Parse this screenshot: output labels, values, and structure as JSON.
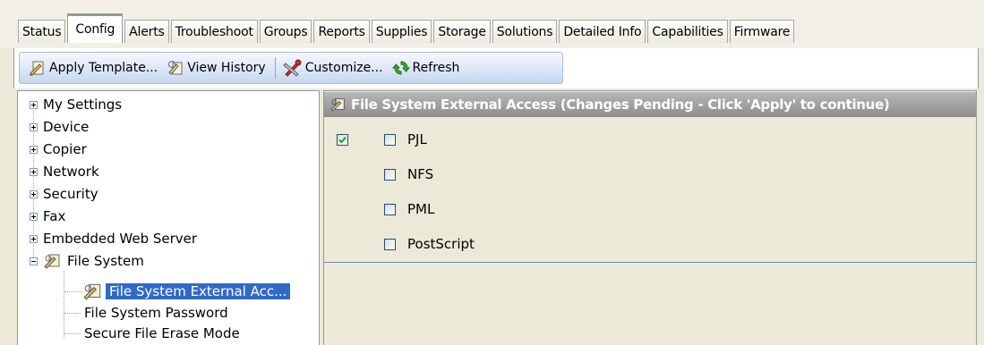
{
  "tabs": [
    {
      "label": "Status",
      "active": false
    },
    {
      "label": "Config",
      "active": true
    },
    {
      "label": "Alerts",
      "active": false
    },
    {
      "label": "Troubleshoot",
      "active": false
    },
    {
      "label": "Groups",
      "active": false
    },
    {
      "label": "Reports",
      "active": false
    },
    {
      "label": "Supplies",
      "active": false
    },
    {
      "label": "Storage",
      "active": false
    },
    {
      "label": "Solutions",
      "active": false
    },
    {
      "label": "Detailed Info",
      "active": false
    },
    {
      "label": "Capabilities",
      "active": false
    },
    {
      "label": "Firmware",
      "active": false
    }
  ],
  "toolbar": {
    "apply_template": "Apply Template...",
    "view_history": "View History",
    "customize": "Customize...",
    "refresh": "Refresh"
  },
  "tree": {
    "items": [
      {
        "label": "My Settings",
        "expander": "plus"
      },
      {
        "label": "Device",
        "expander": "plus"
      },
      {
        "label": "Copier",
        "expander": "plus"
      },
      {
        "label": "Network",
        "expander": "plus"
      },
      {
        "label": "Security",
        "expander": "plus"
      },
      {
        "label": "Fax",
        "expander": "plus"
      },
      {
        "label": "Embedded Web Server",
        "expander": "plus"
      },
      {
        "label": "File System",
        "expander": "minus"
      }
    ],
    "children": [
      {
        "label": "File System External Acc...",
        "selected": true
      },
      {
        "label": "File System Password",
        "selected": false
      },
      {
        "label": "Secure File Erase Mode",
        "selected": false
      }
    ]
  },
  "panel": {
    "title": "File System External Access  (Changes Pending - Click 'Apply' to continue)",
    "enable_checkbox_checked": true,
    "options": [
      {
        "label": "PJL",
        "checked": false
      },
      {
        "label": "NFS",
        "checked": false
      },
      {
        "label": "PML",
        "checked": false
      },
      {
        "label": "PostScript",
        "checked": false
      }
    ]
  },
  "colors": {
    "selection": "#316ac5",
    "header_gray": "#9c9c9c",
    "active_tab_accent": "#ffc83a",
    "check_green": "#21a121"
  },
  "icons": {
    "apply_template": "template-icon",
    "view_history": "history-icon",
    "customize": "customize-icon",
    "refresh": "refresh-icon",
    "file_system": "file-system-icon"
  }
}
